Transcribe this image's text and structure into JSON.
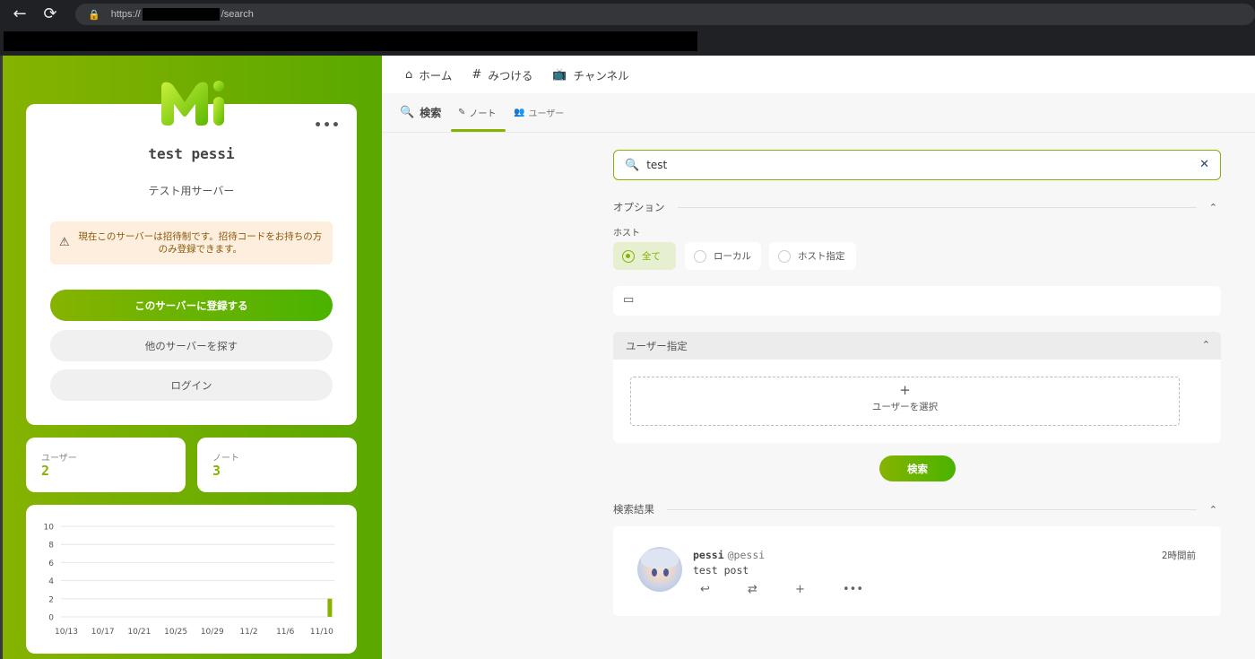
{
  "browser": {
    "url_prefix": "https://",
    "url_suffix": "/search",
    "back_icon": "←",
    "reload_icon": "⟳",
    "lock_icon": "🔒"
  },
  "left": {
    "instance_name": "test pessi",
    "description": "テスト用サーバー",
    "more_icon": "•••",
    "warning_icon": "⚠",
    "warning_text": "現在このサーバーは招待制です。招待コードをお持ちの方のみ登録できます。",
    "register_label": "このサーバーに登録する",
    "explore_label": "他のサーバーを探す",
    "login_label": "ログイン",
    "stats": {
      "users_label": "ユーザー",
      "users_value": "2",
      "notes_label": "ノート",
      "notes_value": "3"
    }
  },
  "chart_data": {
    "type": "bar",
    "categories": [
      "10/13",
      "10/17",
      "10/21",
      "10/25",
      "10/29",
      "11/2",
      "11/6",
      "11/10"
    ],
    "y_ticks": [
      0,
      2,
      4,
      6,
      8,
      10
    ],
    "ylim": [
      0,
      10
    ],
    "series": [
      {
        "values": [
          0,
          0,
          0,
          0,
          0,
          0,
          0,
          0,
          0,
          0,
          0,
          0,
          0,
          0,
          0,
          0,
          0,
          0,
          0,
          0,
          0,
          0,
          0,
          0,
          0,
          0,
          0,
          0,
          0,
          2
        ]
      }
    ],
    "bar_color": "#86b300",
    "grid": true
  },
  "topnav": {
    "items": [
      {
        "icon": "⌂",
        "label": "ホーム"
      },
      {
        "icon": "#",
        "label": "みつける"
      },
      {
        "icon": "📺",
        "label": "チャンネル"
      }
    ]
  },
  "search_page": {
    "title": "検索",
    "title_icon": "🔍",
    "tabs": [
      {
        "icon": "✎",
        "label": "ノート"
      },
      {
        "icon": "👥",
        "label": "ユーザー"
      }
    ],
    "query": "test",
    "clear_icon": "✕",
    "options_label": "オプション",
    "host_label": "ホスト",
    "host_options": [
      "全て",
      "ローカル",
      "ホスト指定"
    ],
    "selected_host": "全て",
    "fold_icon": "▭",
    "user_spec_label": "ユーザー指定",
    "pick_user_plus": "+",
    "pick_user_label": "ユーザーを選択",
    "search_button": "検索",
    "results_label": "検索結果",
    "chevron_up": "⌃"
  },
  "results": [
    {
      "name": "pessi",
      "handle": "@pessi",
      "time": "2時間前",
      "text": "test post",
      "actions": {
        "reply": "↩",
        "renote": "⇄",
        "react": "+",
        "more": "•••"
      }
    }
  ],
  "colors": {
    "accent": "#86b300",
    "accent2": "#4ab300"
  }
}
